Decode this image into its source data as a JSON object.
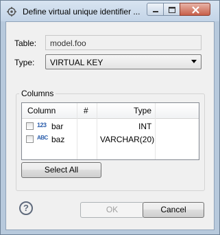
{
  "window": {
    "title": "Define virtual unique identifier ..."
  },
  "form": {
    "table_label": "Table:",
    "table_value": "model.foo",
    "type_label": "Type:",
    "type_value": "VIRTUAL KEY"
  },
  "columns_group": {
    "title": "Columns",
    "headers": {
      "column": "Column",
      "num": "#",
      "type": "Type"
    },
    "rows": [
      {
        "icon_text": "123",
        "icon": "numeric-type-icon",
        "name": "bar",
        "type": "INT",
        "checked": false
      },
      {
        "icon_text": "ABC",
        "icon": "string-type-icon",
        "name": "baz",
        "type": "VARCHAR(20)",
        "checked": false
      }
    ],
    "select_all_label": "Select All"
  },
  "footer": {
    "help_glyph": "?",
    "ok_label": "OK",
    "cancel_label": "Cancel"
  }
}
